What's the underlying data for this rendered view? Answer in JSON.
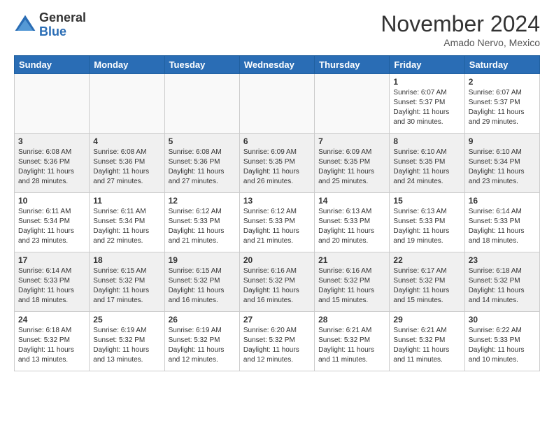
{
  "header": {
    "logo_general": "General",
    "logo_blue": "Blue",
    "month_title": "November 2024",
    "location": "Amado Nervo, Mexico"
  },
  "days_of_week": [
    "Sunday",
    "Monday",
    "Tuesday",
    "Wednesday",
    "Thursday",
    "Friday",
    "Saturday"
  ],
  "weeks": [
    [
      {
        "day": "",
        "info": ""
      },
      {
        "day": "",
        "info": ""
      },
      {
        "day": "",
        "info": ""
      },
      {
        "day": "",
        "info": ""
      },
      {
        "day": "",
        "info": ""
      },
      {
        "day": "1",
        "info": "Sunrise: 6:07 AM\nSunset: 5:37 PM\nDaylight: 11 hours and 30 minutes."
      },
      {
        "day": "2",
        "info": "Sunrise: 6:07 AM\nSunset: 5:37 PM\nDaylight: 11 hours and 29 minutes."
      }
    ],
    [
      {
        "day": "3",
        "info": "Sunrise: 6:08 AM\nSunset: 5:36 PM\nDaylight: 11 hours and 28 minutes."
      },
      {
        "day": "4",
        "info": "Sunrise: 6:08 AM\nSunset: 5:36 PM\nDaylight: 11 hours and 27 minutes."
      },
      {
        "day": "5",
        "info": "Sunrise: 6:08 AM\nSunset: 5:36 PM\nDaylight: 11 hours and 27 minutes."
      },
      {
        "day": "6",
        "info": "Sunrise: 6:09 AM\nSunset: 5:35 PM\nDaylight: 11 hours and 26 minutes."
      },
      {
        "day": "7",
        "info": "Sunrise: 6:09 AM\nSunset: 5:35 PM\nDaylight: 11 hours and 25 minutes."
      },
      {
        "day": "8",
        "info": "Sunrise: 6:10 AM\nSunset: 5:35 PM\nDaylight: 11 hours and 24 minutes."
      },
      {
        "day": "9",
        "info": "Sunrise: 6:10 AM\nSunset: 5:34 PM\nDaylight: 11 hours and 23 minutes."
      }
    ],
    [
      {
        "day": "10",
        "info": "Sunrise: 6:11 AM\nSunset: 5:34 PM\nDaylight: 11 hours and 23 minutes."
      },
      {
        "day": "11",
        "info": "Sunrise: 6:11 AM\nSunset: 5:34 PM\nDaylight: 11 hours and 22 minutes."
      },
      {
        "day": "12",
        "info": "Sunrise: 6:12 AM\nSunset: 5:33 PM\nDaylight: 11 hours and 21 minutes."
      },
      {
        "day": "13",
        "info": "Sunrise: 6:12 AM\nSunset: 5:33 PM\nDaylight: 11 hours and 21 minutes."
      },
      {
        "day": "14",
        "info": "Sunrise: 6:13 AM\nSunset: 5:33 PM\nDaylight: 11 hours and 20 minutes."
      },
      {
        "day": "15",
        "info": "Sunrise: 6:13 AM\nSunset: 5:33 PM\nDaylight: 11 hours and 19 minutes."
      },
      {
        "day": "16",
        "info": "Sunrise: 6:14 AM\nSunset: 5:33 PM\nDaylight: 11 hours and 18 minutes."
      }
    ],
    [
      {
        "day": "17",
        "info": "Sunrise: 6:14 AM\nSunset: 5:33 PM\nDaylight: 11 hours and 18 minutes."
      },
      {
        "day": "18",
        "info": "Sunrise: 6:15 AM\nSunset: 5:32 PM\nDaylight: 11 hours and 17 minutes."
      },
      {
        "day": "19",
        "info": "Sunrise: 6:15 AM\nSunset: 5:32 PM\nDaylight: 11 hours and 16 minutes."
      },
      {
        "day": "20",
        "info": "Sunrise: 6:16 AM\nSunset: 5:32 PM\nDaylight: 11 hours and 16 minutes."
      },
      {
        "day": "21",
        "info": "Sunrise: 6:16 AM\nSunset: 5:32 PM\nDaylight: 11 hours and 15 minutes."
      },
      {
        "day": "22",
        "info": "Sunrise: 6:17 AM\nSunset: 5:32 PM\nDaylight: 11 hours and 15 minutes."
      },
      {
        "day": "23",
        "info": "Sunrise: 6:18 AM\nSunset: 5:32 PM\nDaylight: 11 hours and 14 minutes."
      }
    ],
    [
      {
        "day": "24",
        "info": "Sunrise: 6:18 AM\nSunset: 5:32 PM\nDaylight: 11 hours and 13 minutes."
      },
      {
        "day": "25",
        "info": "Sunrise: 6:19 AM\nSunset: 5:32 PM\nDaylight: 11 hours and 13 minutes."
      },
      {
        "day": "26",
        "info": "Sunrise: 6:19 AM\nSunset: 5:32 PM\nDaylight: 11 hours and 12 minutes."
      },
      {
        "day": "27",
        "info": "Sunrise: 6:20 AM\nSunset: 5:32 PM\nDaylight: 11 hours and 12 minutes."
      },
      {
        "day": "28",
        "info": "Sunrise: 6:21 AM\nSunset: 5:32 PM\nDaylight: 11 hours and 11 minutes."
      },
      {
        "day": "29",
        "info": "Sunrise: 6:21 AM\nSunset: 5:32 PM\nDaylight: 11 hours and 11 minutes."
      },
      {
        "day": "30",
        "info": "Sunrise: 6:22 AM\nSunset: 5:33 PM\nDaylight: 11 hours and 10 minutes."
      }
    ]
  ]
}
